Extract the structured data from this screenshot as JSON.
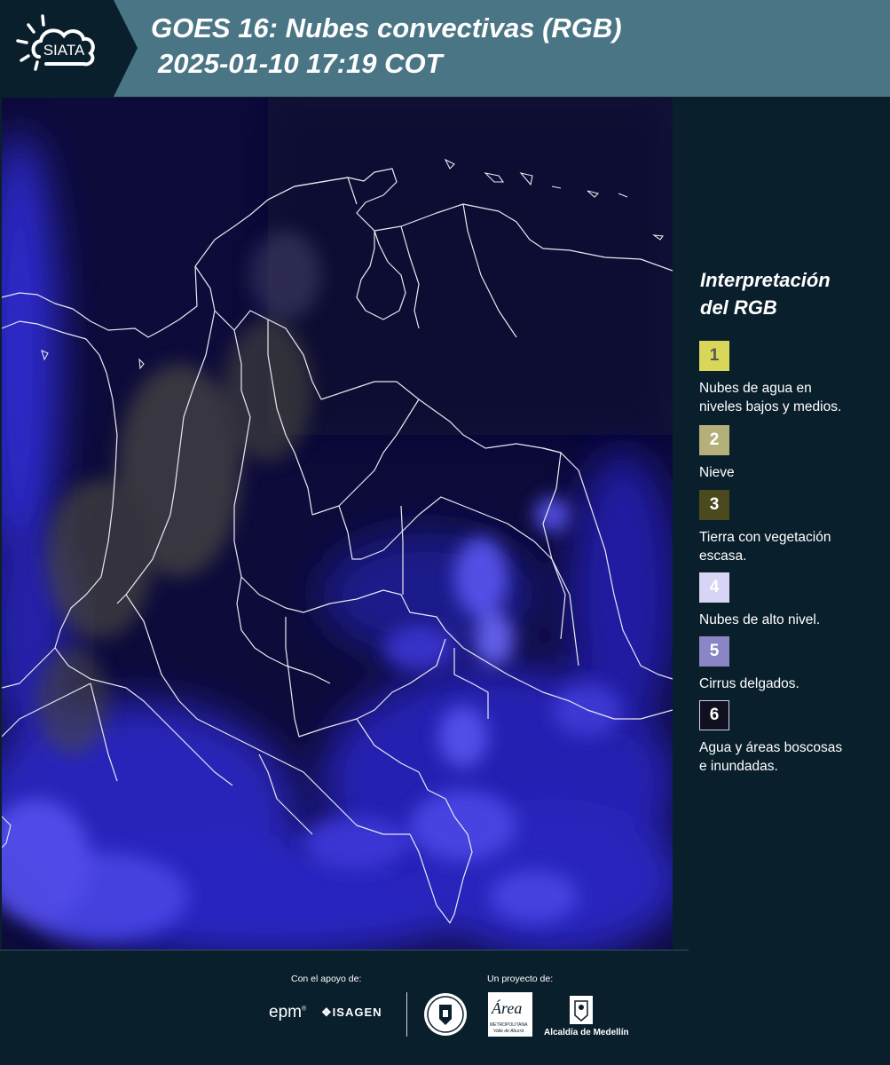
{
  "header": {
    "logo_text": "SIATA",
    "title_line1": "GOES 16: Nubes convectivas (RGB)",
    "title_line2": "2025-01-10 17:19 COT"
  },
  "legend": {
    "title_line1": "Interpretación",
    "title_line2": "del RGB",
    "items": [
      {
        "number": "1",
        "label_line1": "Nubes de agua en",
        "label_line2": "niveles bajos y medios.",
        "color": "#d9d75a",
        "text_color": "#555555"
      },
      {
        "number": "2",
        "label_line1": "Nieve",
        "label_line2": "",
        "color": "#b5b07a",
        "text_color": "#ffffff"
      },
      {
        "number": "3",
        "label_line1": "Tierra con vegetación",
        "label_line2": "escasa.",
        "color": "#4a4a1e",
        "text_color": "#ffffff"
      },
      {
        "number": "4",
        "label_line1": "Nubes de alto nivel.",
        "label_line2": "",
        "color": "#d7d5f5",
        "text_color": "#ffffff"
      },
      {
        "number": "5",
        "label_line1": "Cirrus delgados.",
        "label_line2": "",
        "color": "#8a86c6",
        "text_color": "#ffffff"
      },
      {
        "number": "6",
        "label_line1": "Agua y áreas boscosas",
        "label_line2": "e inundadas.",
        "color": "#101020",
        "text_color": "#ffffff"
      }
    ]
  },
  "footer": {
    "support_label": "Con el apoyo de:",
    "project_label": "Un proyecto de:",
    "epm": "epm",
    "isagen": "ISAGEN",
    "area_name": "Área",
    "area_sub1": "METROPOLITANA",
    "area_sub2": "Valle de Aburrá",
    "alcaldia": "Alcaldía de Medellín"
  },
  "colors": {
    "header_bg": "#4a7585",
    "page_bg": "#0a1f2c",
    "map_bg": "#0d0b3a",
    "cloud_blue": "#3a35d8"
  }
}
